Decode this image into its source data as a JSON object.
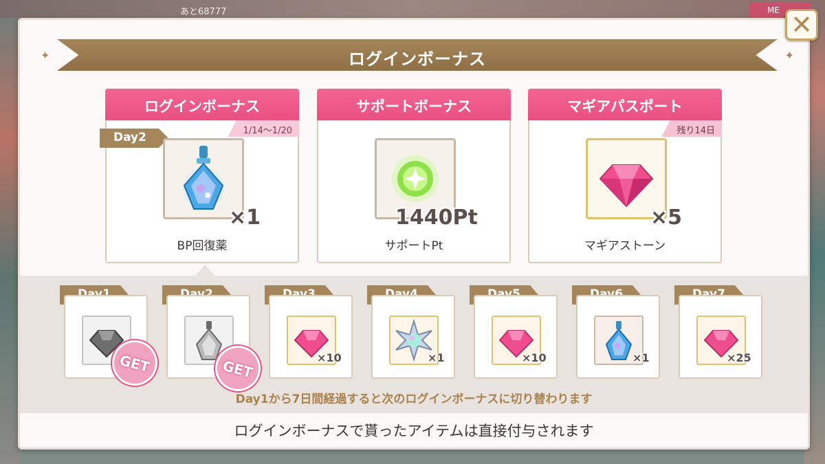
{
  "background": {
    "counter_text": "あと68777",
    "menu_label": "ME"
  },
  "modal": {
    "title": "ログインボーナス",
    "close_icon": "close-icon"
  },
  "cards": [
    {
      "header": "ログインボーナス",
      "period": "1/14〜1/20",
      "day_tab": "Day2",
      "item_icon": "bp-potion-icon",
      "quantity": "×1",
      "label": "BP回復薬"
    },
    {
      "header": "サポートボーナス",
      "item_icon": "support-orb-icon",
      "quantity": "1440Pt",
      "label": "サポートPt"
    },
    {
      "header": "マギアパスポート",
      "remaining": "残り14日",
      "item_icon": "magia-stone-icon",
      "quantity": "×5",
      "label": "マギアストーン"
    }
  ],
  "days": [
    {
      "label": "Day1",
      "item_icon": "gem-icon",
      "quantity": "",
      "claimed": true,
      "get_label": "GET"
    },
    {
      "label": "Day2",
      "item_icon": "potion-icon",
      "quantity": "",
      "claimed": true,
      "get_label": "GET"
    },
    {
      "label": "Day3",
      "item_icon": "magia-stone-icon",
      "quantity": "×10",
      "claimed": false
    },
    {
      "label": "Day4",
      "item_icon": "crystal-star-icon",
      "quantity": "×1",
      "claimed": false
    },
    {
      "label": "Day5",
      "item_icon": "magia-stone-icon",
      "quantity": "×10",
      "claimed": false
    },
    {
      "label": "Day6",
      "item_icon": "bp-potion-icon",
      "quantity": "×1",
      "claimed": false
    },
    {
      "label": "Day7",
      "item_icon": "magia-stone-icon",
      "quantity": "×25",
      "claimed": false
    }
  ],
  "note": "Day1から7日間経過すると次のログインボーナスに切り替わります",
  "footer": "ログインボーナスで貰ったアイテムは直接付与されます",
  "colors": {
    "accent_pink": "#e85080",
    "banner_gold": "#a5865b",
    "text_gold": "#a9824d"
  }
}
